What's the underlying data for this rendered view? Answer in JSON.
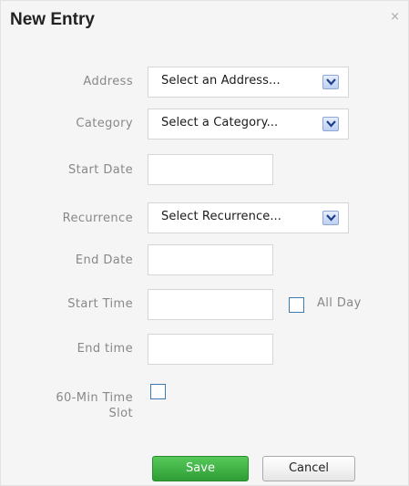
{
  "dialog": {
    "title": "New Entry",
    "close_glyph": "×"
  },
  "form": {
    "address": {
      "label": "Address",
      "value": "Select an Address..."
    },
    "category": {
      "label": "Category",
      "value": "Select a Category..."
    },
    "start_date": {
      "label": "Start Date",
      "value": ""
    },
    "recurrence": {
      "label": "Recurrence",
      "value": "Select Recurrence..."
    },
    "end_date": {
      "label": "End Date",
      "value": ""
    },
    "start_time": {
      "label": "Start Time",
      "value": ""
    },
    "all_day": {
      "label": "All Day",
      "checked": false
    },
    "end_time": {
      "label": "End time",
      "value": ""
    },
    "slot60": {
      "label_line1": "60-Min Time",
      "label_line2": "Slot",
      "checked": false
    }
  },
  "buttons": {
    "save": "Save",
    "cancel": "Cancel"
  },
  "colors": {
    "save_green": "#3cb043",
    "checkbox_border": "#3d7ab3",
    "label_gray": "#888888"
  }
}
